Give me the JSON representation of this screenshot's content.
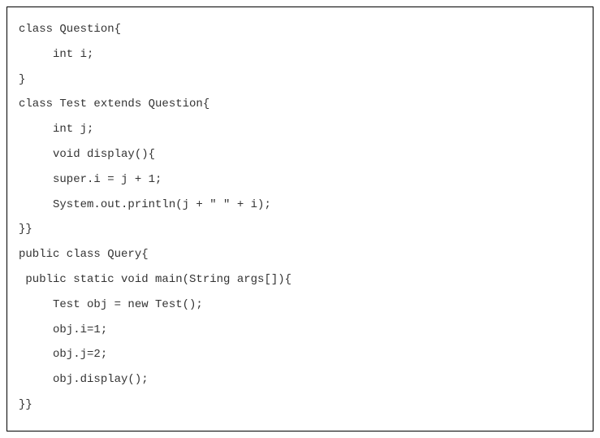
{
  "code": {
    "lines": [
      "class Question{",
      "     int i;",
      "}",
      "class Test extends Question{",
      "     int j;",
      "     void display(){",
      "     super.i = j + 1;",
      "     System.out.println(j + \" \" + i);",
      "}}",
      "public class Query{",
      " public static void main(String args[]){",
      "     Test obj = new Test();",
      "     obj.i=1;",
      "     obj.j=2;",
      "     obj.display();",
      "}}"
    ]
  }
}
